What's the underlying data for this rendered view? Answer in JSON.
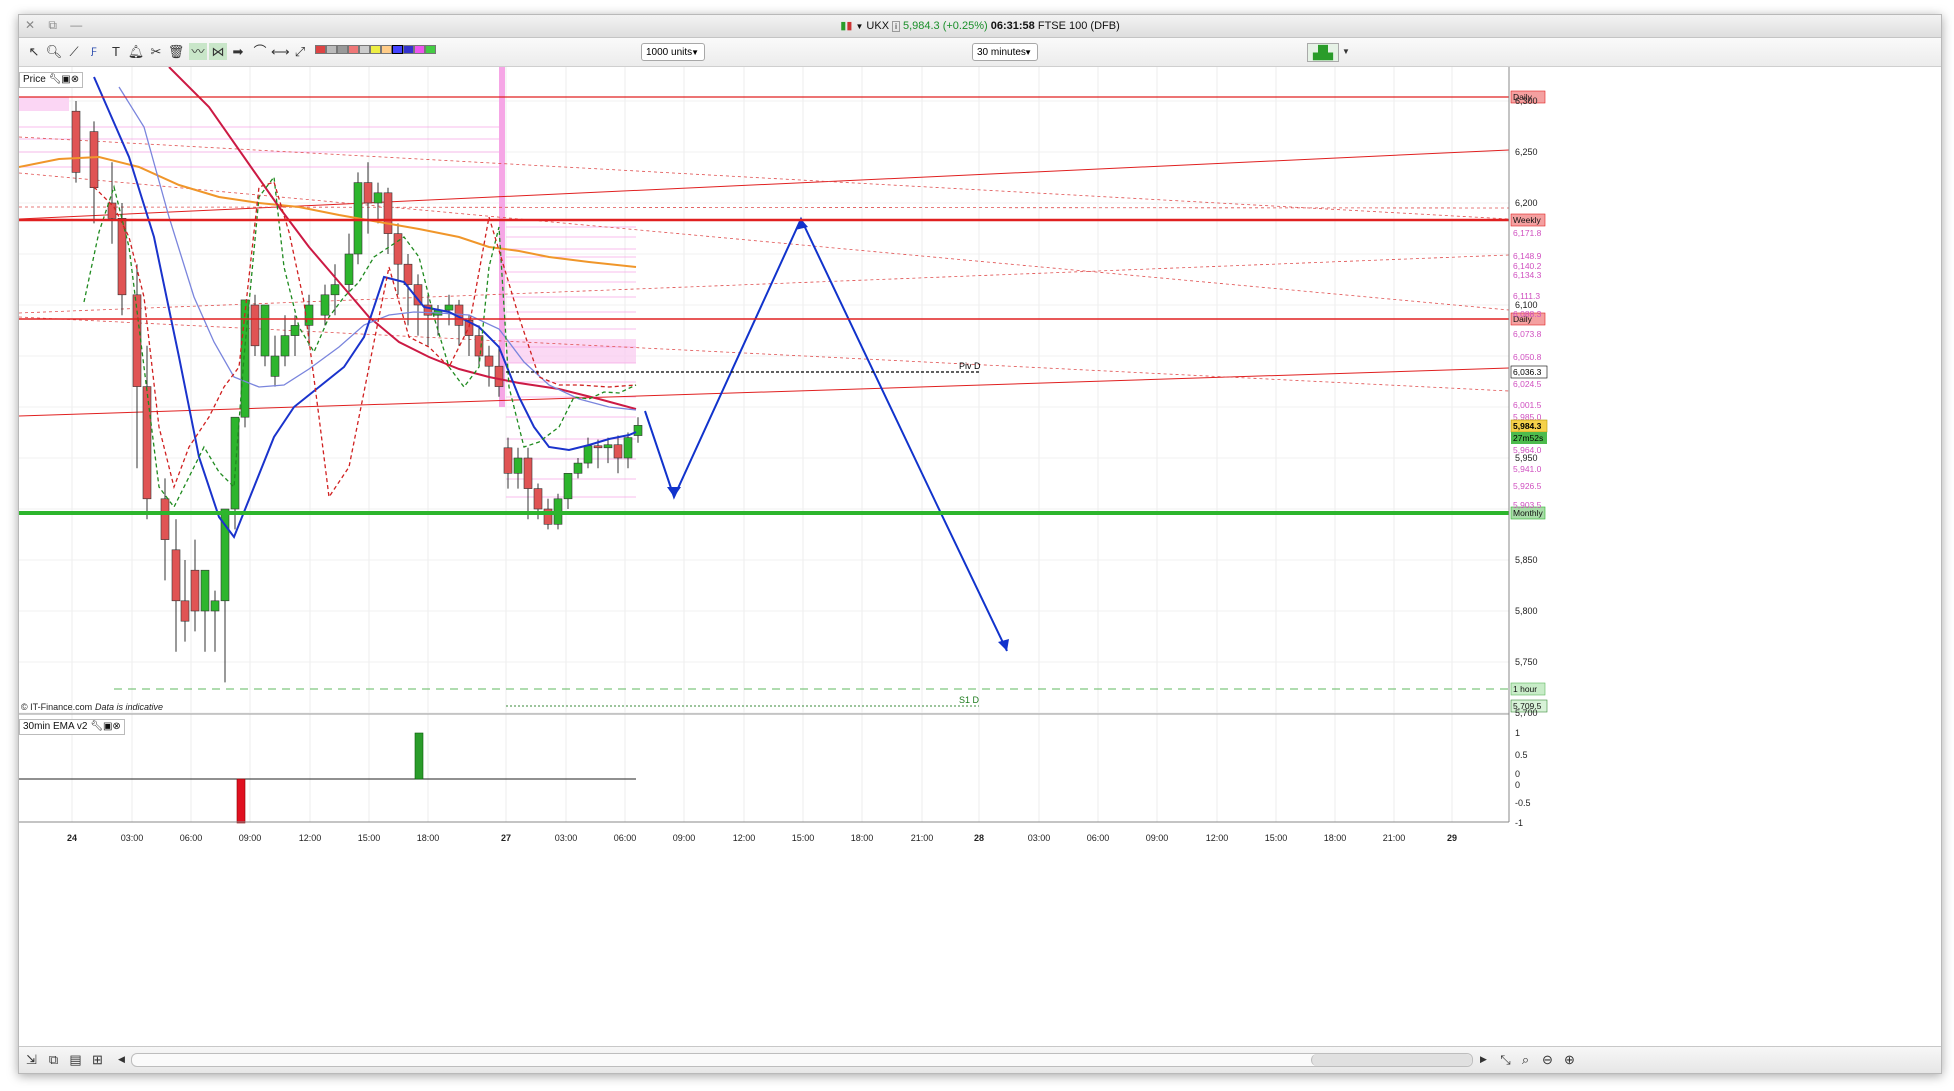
{
  "window": {
    "symbol": "UKX",
    "price_text": "5,984.3",
    "change_text": "(+0.25%)",
    "time": "06:31:58",
    "instrument": "FTSE 100 (DFB)"
  },
  "toolbar": {
    "units_select": "1000 units",
    "interval_select": "30 minutes"
  },
  "panes": {
    "price": {
      "label": "Price"
    },
    "indicator": {
      "label": "30min EMA v2"
    }
  },
  "chart": {
    "copyright": "© IT-Finance.com",
    "disclaimer": "Data is indicative",
    "price_axis": [
      "6,300",
      "6,250",
      "6,200",
      "6,100",
      "5,950",
      "5,850",
      "5,800",
      "5,750",
      "5,700"
    ],
    "indicator_axis": [
      "1",
      "0.5",
      "0",
      "0",
      "-0.5",
      "-1"
    ],
    "time_axis": [
      "24",
      "03:00",
      "06:00",
      "09:00",
      "12:00",
      "15:00",
      "18:00",
      "27",
      "03:00",
      "06:00",
      "09:00",
      "12:00",
      "15:00",
      "18:00",
      "21:00",
      "28",
      "03:00",
      "06:00",
      "09:00",
      "12:00",
      "15:00",
      "18:00",
      "21:00",
      "29"
    ],
    "level_labels": {
      "daily_top": "Daily",
      "weekly": "Weekly",
      "daily_mid": "Daily",
      "monthly": "Monthly",
      "hour": "1 hour",
      "current_price": "5,984.3",
      "countdown": "27m52s",
      "piv": "6,036.3",
      "s1": "5,709.5"
    },
    "pink_levels": [
      "6,171.8",
      "6,148.9",
      "6,140.2",
      "6,134.3",
      "6,111.3",
      "6,088.3",
      "6,073.8",
      "6,050.8",
      "6,024.5",
      "6,001.5",
      "5,985.0",
      "5,964.0",
      "5,941.0",
      "5,926.5",
      "5,903.5"
    ],
    "annotations": {
      "piv_d": "Piv D",
      "s1_d": "S1 D"
    },
    "colors": {
      "up": "#2db52d",
      "down": "#e05454",
      "monthly": "#2db52d",
      "resistance": "#e02020",
      "ema_fast": "#1a33cc",
      "ema_slow": "#cc1a44",
      "ema_long": "#f0962a",
      "projection": "#1133cc",
      "pivot_zone": "#f6a6e6"
    }
  }
}
